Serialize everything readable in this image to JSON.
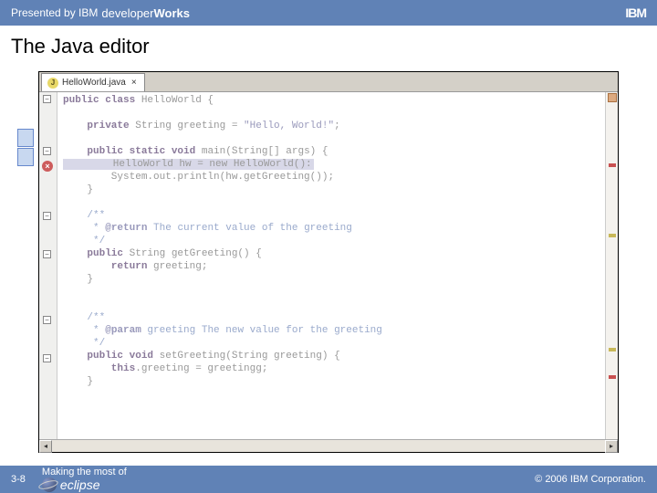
{
  "header": {
    "presented_by": "Presented by IBM",
    "brand_light": "developer",
    "brand_bold": "Works",
    "logo": "IBM"
  },
  "title": "The Java editor",
  "editor": {
    "tab": {
      "filename": "HelloWorld.java",
      "icon_letter": "J"
    },
    "code": {
      "l1_a": "public",
      "l1_b": " class",
      "l1_c": " HelloWorld {",
      "l3_a": "    private",
      "l3_b": " String greeting = ",
      "l3_c": "\"Hello, World!\"",
      "l3_d": ";",
      "l5_a": "    public",
      "l5_b": " static",
      "l5_c": " void",
      "l5_d": " main(String[] args) {",
      "l6": "        HelloWorld hw = new HelloWorld():",
      "l7": "        System.out.println(hw.getGreeting());",
      "l8": "    }",
      "l10": "    /**",
      "l11_a": "     * ",
      "l11_b": "@return",
      "l11_c": " The current value of the greeting",
      "l12": "     */",
      "l13_a": "    public",
      "l13_b": " String getGreeting() {",
      "l14_a": "        return",
      "l14_b": " greeting;",
      "l15": "    }",
      "l18": "    /**",
      "l19_a": "     * ",
      "l19_b": "@param",
      "l19_c": " greeting The new value for the greeting",
      "l20": "     */",
      "l21_a": "    public",
      "l21_b": " void",
      "l21_c": " setGreeting(String greeting) {",
      "l22_a": "        this",
      "l22_b": ".greeting = greetingg;",
      "l23": "    }"
    }
  },
  "footer": {
    "page_num": "3-8",
    "making": "Making the most of",
    "eclipse": "eclipse",
    "copyright": "© 2006 IBM Corporation."
  }
}
